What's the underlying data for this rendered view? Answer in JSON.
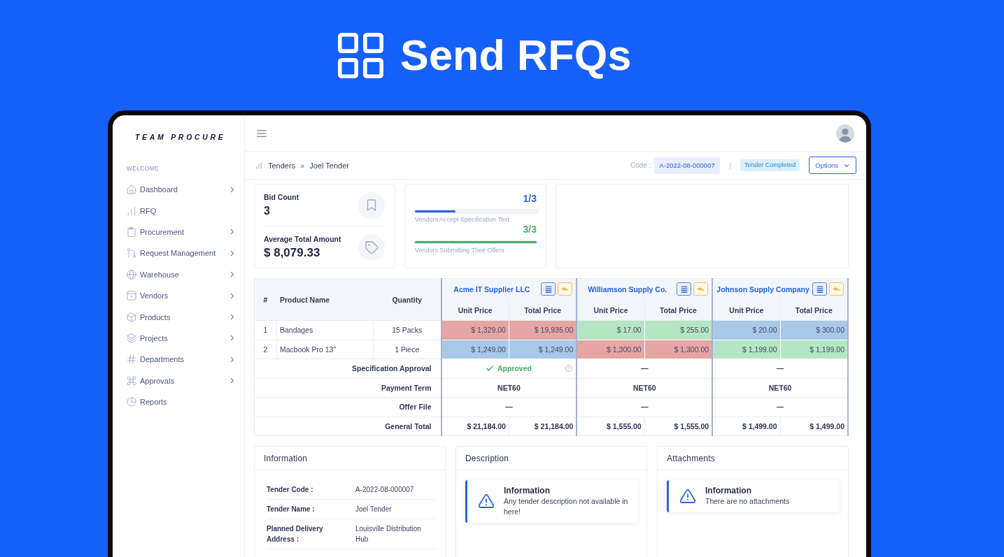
{
  "hero": {
    "title": "Send RFQs"
  },
  "sidebar": {
    "logo": "TEAM PROCURE",
    "section": "WELCOME",
    "items": [
      {
        "label": "Dashboard",
        "has_submenu": true
      },
      {
        "label": "RFQ",
        "has_submenu": false
      },
      {
        "label": "Procurement",
        "has_submenu": true
      },
      {
        "label": "Request Management",
        "has_submenu": true
      },
      {
        "label": "Warehouse",
        "has_submenu": true
      },
      {
        "label": "Vendors",
        "has_submenu": true
      },
      {
        "label": "Products",
        "has_submenu": true
      },
      {
        "label": "Projects",
        "has_submenu": true
      },
      {
        "label": "Departments",
        "has_submenu": true
      },
      {
        "label": "Approvals",
        "has_submenu": true
      },
      {
        "label": "Reports",
        "has_submenu": false
      }
    ]
  },
  "breadcrumb": {
    "items": [
      "Tenders",
      "Joel Tender"
    ],
    "separator": "»"
  },
  "header": {
    "code_label": "Code :",
    "code": "A-2022-08-000007",
    "status": "Tender Completed",
    "options_button": "Options"
  },
  "stats": {
    "bid_count_label": "Bid Count",
    "bid_count": "3",
    "average_label": "Average Total Amount",
    "average": "$ 8,079.33"
  },
  "progress": [
    {
      "fraction": "1/3",
      "label": "Vendors Accept Specification Text",
      "level": 0.333,
      "color": "#2f5fe3"
    },
    {
      "fraction": "3/3",
      "label": "Vendors Submitting Their Offers",
      "level": 1,
      "color": "#4aae6e"
    }
  ],
  "table": {
    "columns": [
      "#",
      "Product Name",
      "Quantity"
    ],
    "vendors": [
      {
        "name": "Acme IT Supplier LLC",
        "columns": [
          "Unit Price",
          "Total Price"
        ]
      },
      {
        "name": "Williamson Supply Co.",
        "columns": [
          "Unit Price",
          "Total Price"
        ]
      },
      {
        "name": "Johnson Supply Company",
        "columns": [
          "Unit Price",
          "Total Price"
        ]
      }
    ],
    "rows": [
      {
        "number": "1",
        "product": "Bandages",
        "quantity": "15 Packs",
        "prices": [
          {
            "unit": "$ 1,329.00",
            "total": "$ 19,935.00",
            "color": "#e6a6a4"
          },
          {
            "unit": "$ 17.00",
            "total": "$ 255.00",
            "color": "#b4e6c4"
          },
          {
            "unit": "$ 20.00",
            "total": "$ 300.00",
            "color": "#a8c8e8"
          }
        ]
      },
      {
        "number": "2",
        "product": "Macbook Pro 13\"",
        "quantity": "1 Piece",
        "prices": [
          {
            "unit": "$ 1,249.00",
            "total": "$ 1,249.00",
            "color": "#a8c8e8"
          },
          {
            "unit": "$ 1,300.00",
            "total": "$ 1,300.00",
            "color": "#e6a6a4"
          },
          {
            "unit": "$ 1,199.00",
            "total": "$ 1,199.00",
            "color": "#b4e6c4"
          }
        ]
      }
    ],
    "summary": [
      {
        "label": "Specification Approval",
        "kind": "status",
        "cells": [
          {
            "kind": "approved",
            "text": "Approved"
          },
          {
            "kind": "none",
            "text": "—"
          },
          {
            "kind": "none",
            "text": "—"
          }
        ]
      },
      {
        "label": "Payment Term",
        "kind": "merged",
        "cells": [
          "NET60",
          "NET60",
          "NET60"
        ]
      },
      {
        "label": "Offer File",
        "kind": "merged",
        "cells": [
          "—",
          "—",
          "—"
        ]
      },
      {
        "label": "General Total",
        "kind": "split",
        "cells": [
          [
            "$ 21,184.00",
            "$ 21,184.00"
          ],
          [
            "$ 1,555.00",
            "$ 1,555.00"
          ],
          [
            "$ 1,499.00",
            "$ 1,499.00"
          ]
        ]
      }
    ]
  },
  "information": {
    "title": "Information",
    "fields": [
      {
        "label": "Tender Code :",
        "value": "A-2022-08-000007"
      },
      {
        "label": "Tender Name :",
        "value": "Joel Tender"
      },
      {
        "label": "Planned Delivery Address :",
        "value": "Louisville Distribution Hub"
      }
    ]
  },
  "description": {
    "title": "Description",
    "alert": {
      "title": "Information",
      "text": "Any tender description not available in here!"
    }
  },
  "attachments": {
    "title": "Attachments",
    "alert": {
      "title": "Information",
      "text": "There are no attachments"
    }
  }
}
